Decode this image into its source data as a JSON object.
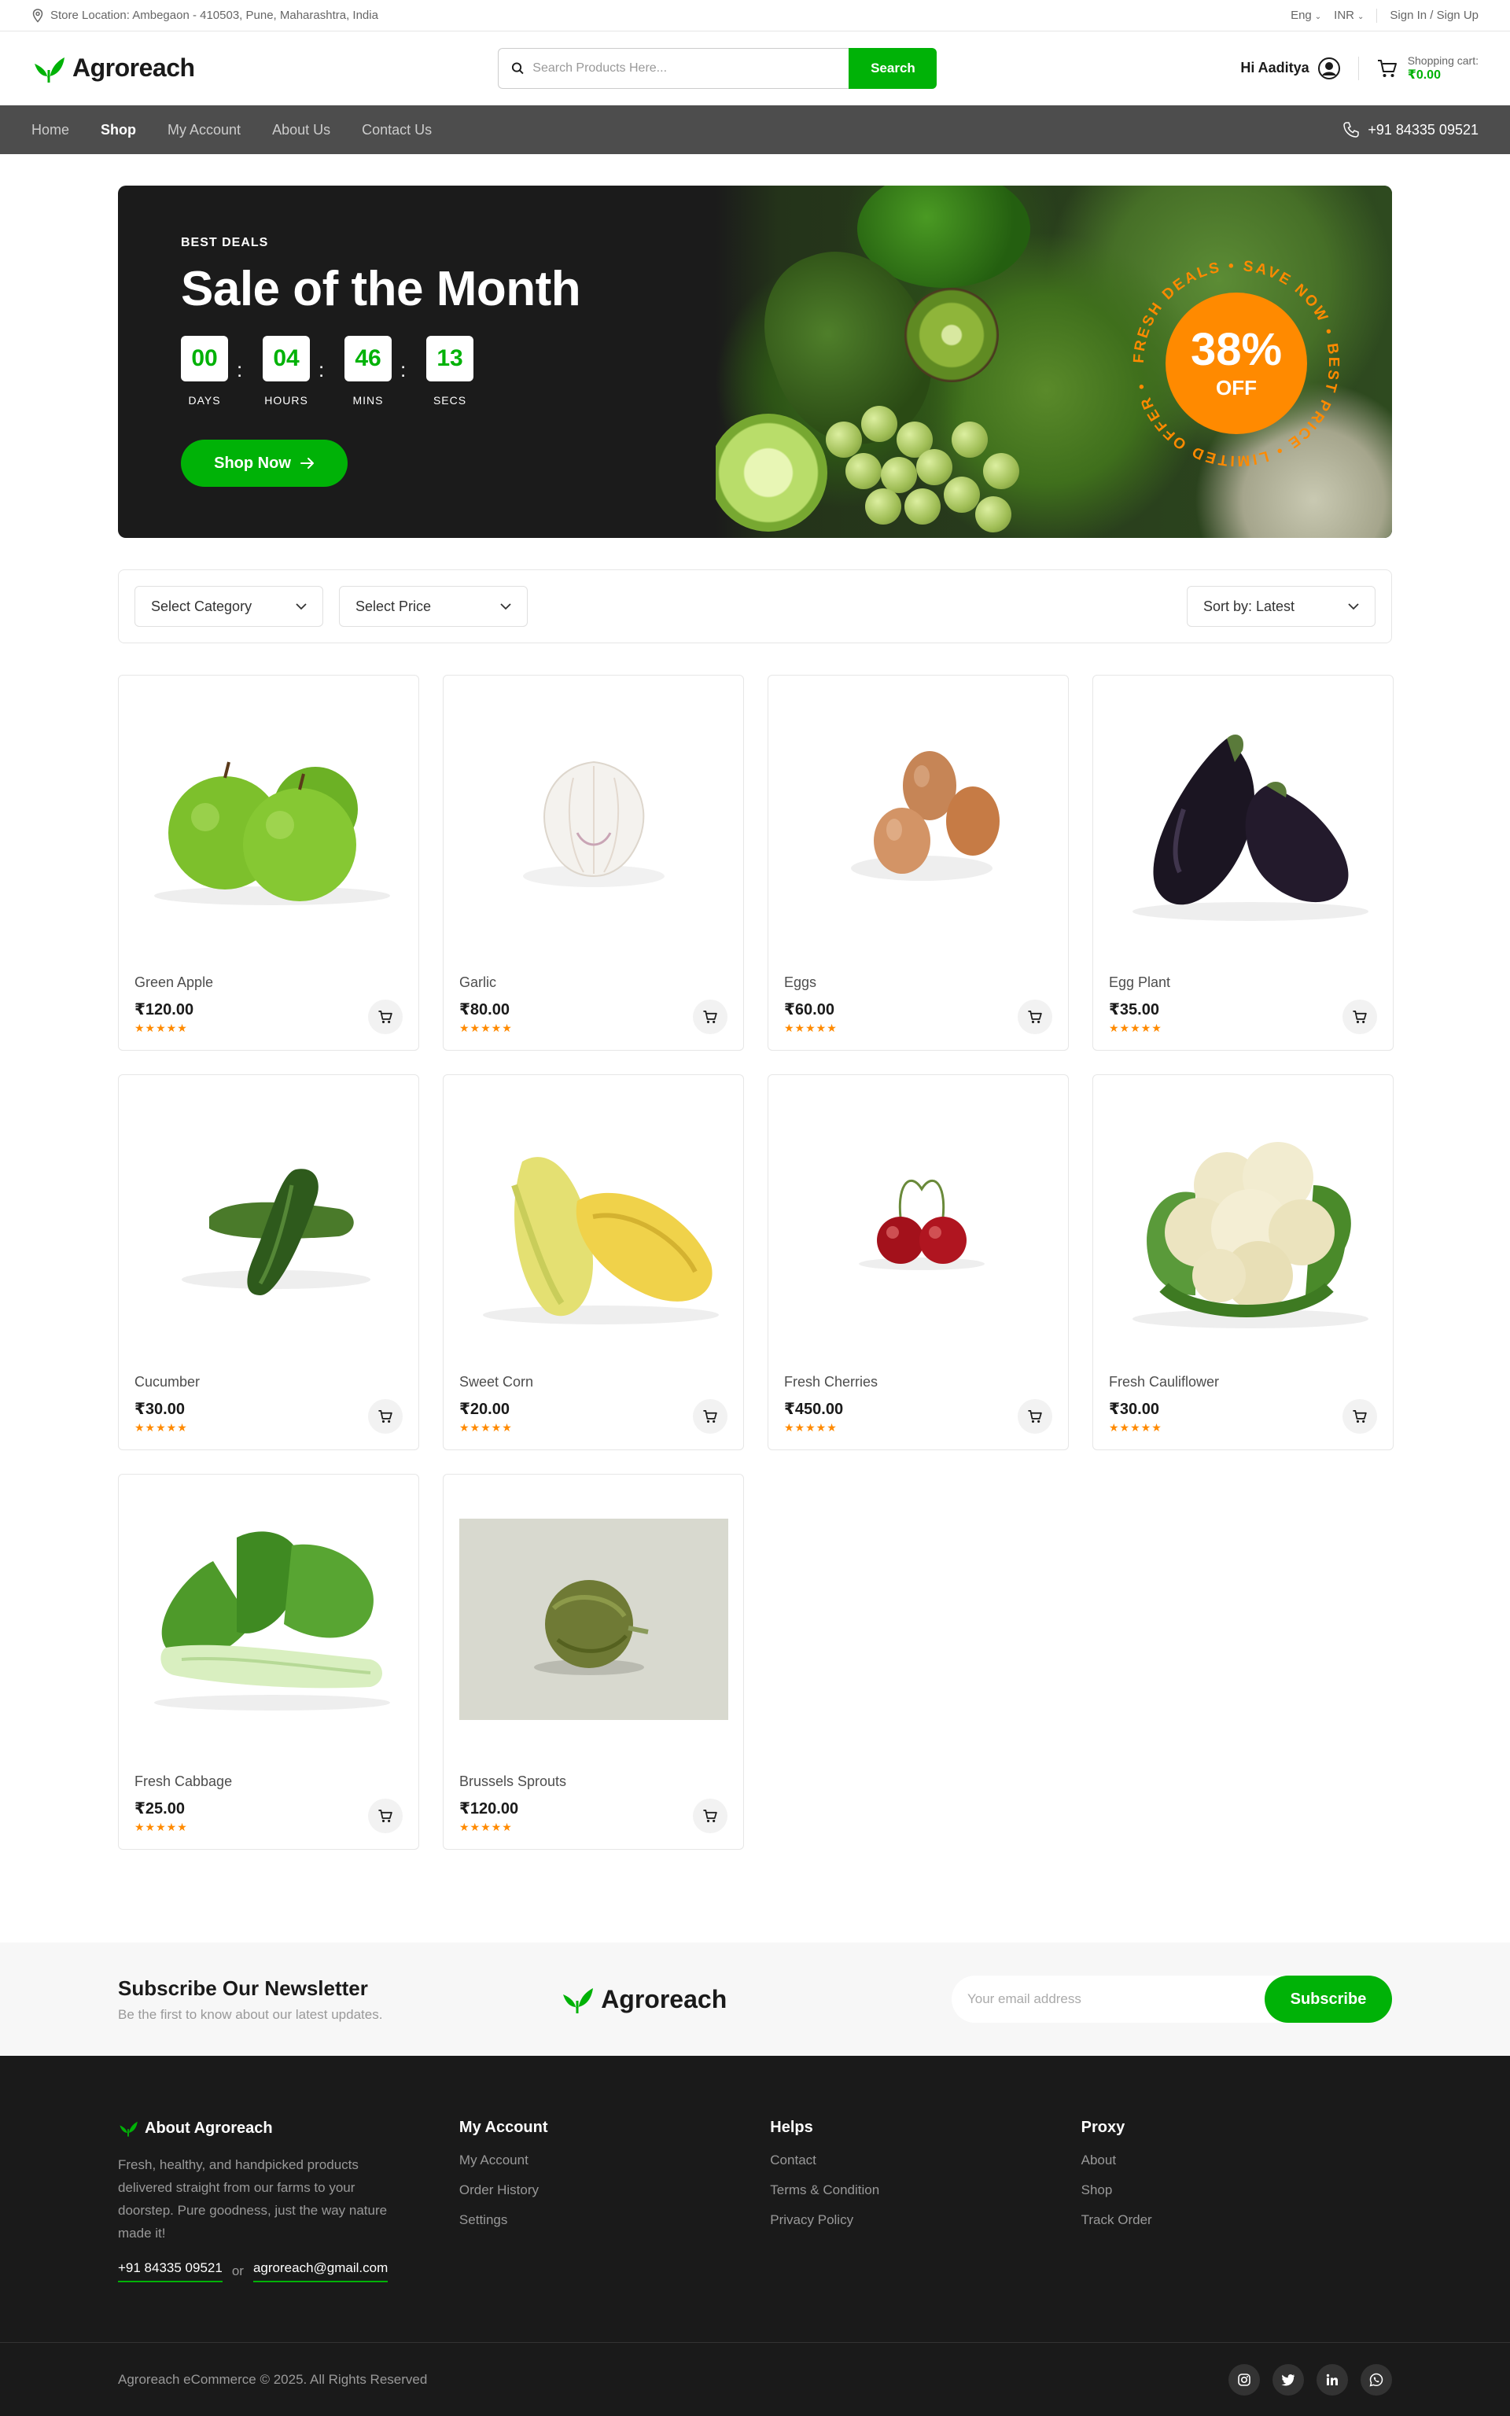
{
  "topbar": {
    "location": "Store Location: Ambegaon - 410503, Pune, Maharashtra, India",
    "language": "Eng",
    "currency": "INR",
    "signin": "Sign In",
    "separator": "/",
    "signup": "Sign Up"
  },
  "header": {
    "brand": "Agroreach",
    "search_placeholder": "Search Products Here...",
    "search_button": "Search",
    "greeting": "Hi Aaditya",
    "cart_label": "Shopping cart:",
    "cart_amount": "₹0.00"
  },
  "nav": {
    "items": [
      "Home",
      "Shop",
      "My Account",
      "About Us",
      "Contact Us"
    ],
    "active": "Shop",
    "phone": "+91 84335 09521"
  },
  "banner": {
    "eyebrow": "BEST DEALS",
    "title": "Sale of the Month",
    "countdown": [
      {
        "value": "00",
        "label": "DAYS"
      },
      {
        "value": "04",
        "label": "HOURS"
      },
      {
        "value": "46",
        "label": "MINS"
      },
      {
        "value": "13",
        "label": "SECS"
      }
    ],
    "cta": "Shop Now",
    "badge_percent": "38%",
    "badge_off": "OFF",
    "badge_ring_text": "FRESH DEALS • SAVE NOW • BEST PRICE • LIMITED OFFER •"
  },
  "filters": {
    "category": "Select Category",
    "price": "Select Price",
    "sort": "Sort by: Latest"
  },
  "products": [
    {
      "name": "Green Apple",
      "price": "₹120.00",
      "rating": 5,
      "image": "green-apple"
    },
    {
      "name": "Garlic",
      "price": "₹80.00",
      "rating": 5,
      "image": "garlic"
    },
    {
      "name": "Eggs",
      "price": "₹60.00",
      "rating": 5,
      "image": "eggs"
    },
    {
      "name": "Egg Plant",
      "price": "₹35.00",
      "rating": 5,
      "image": "eggplant"
    },
    {
      "name": "Cucumber",
      "price": "₹30.00",
      "rating": 5,
      "image": "cucumber"
    },
    {
      "name": "Sweet Corn",
      "price": "₹20.00",
      "rating": 5,
      "image": "corn"
    },
    {
      "name": "Fresh Cherries",
      "price": "₹450.00",
      "rating": 5,
      "image": "cherries"
    },
    {
      "name": "Fresh Cauliflower",
      "price": "₹30.00",
      "rating": 5,
      "image": "cauliflower"
    },
    {
      "name": "Fresh Cabbage",
      "price": "₹25.00",
      "rating": 5,
      "image": "bok-choy"
    },
    {
      "name": "Brussels Sprouts",
      "price": "₹120.00",
      "rating": 5,
      "image": "brussels-sprout"
    }
  ],
  "newsletter": {
    "title": "Subscribe Our Newsletter",
    "subtitle": "Be the first to know about our latest updates.",
    "brand": "Agroreach",
    "placeholder": "Your email address",
    "button": "Subscribe"
  },
  "footer": {
    "about_title": "About Agroreach",
    "about_text": "Fresh, healthy, and handpicked products delivered straight from our farms to your doorstep. Pure goodness, just the way nature made it!",
    "phone": "+91 84335 09521",
    "or": "or",
    "email": "agroreach@gmail.com",
    "columns": [
      {
        "title": "My Account",
        "links": [
          "My Account",
          "Order History",
          "Settings"
        ]
      },
      {
        "title": "Helps",
        "links": [
          "Contact",
          "Terms & Condition",
          "Privacy Policy"
        ]
      },
      {
        "title": "Proxy",
        "links": [
          "About",
          "Shop",
          "Track Order"
        ]
      }
    ],
    "copyright": "Agroreach eCommerce © 2025. All Rights Reserved",
    "socials": [
      "instagram",
      "twitter",
      "linkedin",
      "whatsapp"
    ]
  },
  "colors": {
    "primary": "#00b207",
    "accent": "#ff8a00",
    "nav_bg": "#4d4d4d",
    "footer_bg": "#1a1a1a"
  }
}
